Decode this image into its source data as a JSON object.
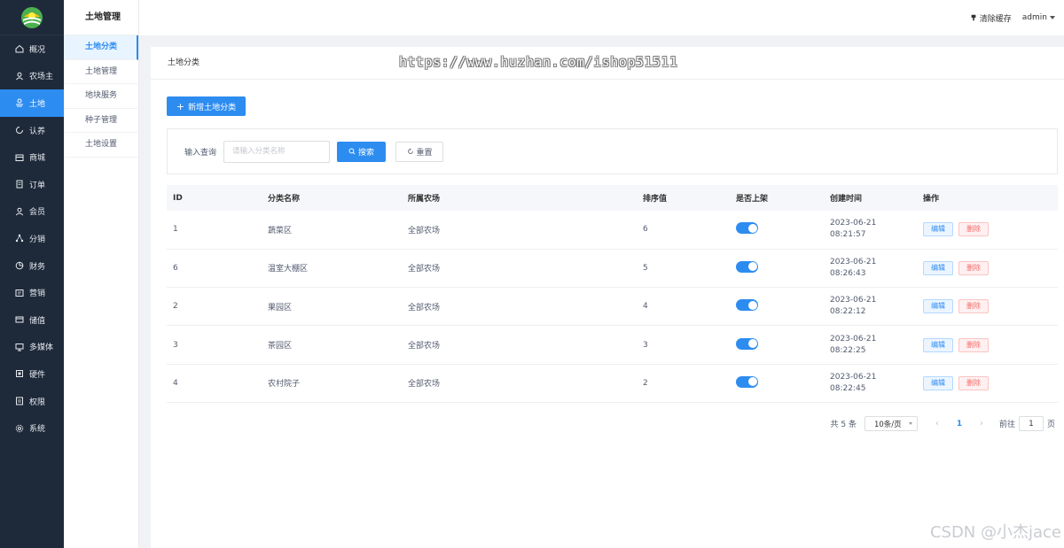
{
  "sidebar": {
    "items": [
      {
        "label": "概况",
        "icon": "home-icon",
        "active": false
      },
      {
        "label": "农场主",
        "icon": "user-icon",
        "active": false
      },
      {
        "label": "土地",
        "icon": "land-icon",
        "active": true
      },
      {
        "label": "认养",
        "icon": "refresh-icon",
        "active": false
      },
      {
        "label": "商城",
        "icon": "shop-icon",
        "active": false
      },
      {
        "label": "订单",
        "icon": "order-icon",
        "active": false
      },
      {
        "label": "会员",
        "icon": "member-icon",
        "active": false
      },
      {
        "label": "分销",
        "icon": "share-icon",
        "active": false
      },
      {
        "label": "财务",
        "icon": "pie-icon",
        "active": false
      },
      {
        "label": "营销",
        "icon": "marketing-icon",
        "active": false
      },
      {
        "label": "储值",
        "icon": "wallet-icon",
        "active": false
      },
      {
        "label": "多媒体",
        "icon": "monitor-icon",
        "active": false
      },
      {
        "label": "硬件",
        "icon": "hardware-icon",
        "active": false
      },
      {
        "label": "权限",
        "icon": "permission-icon",
        "active": false
      },
      {
        "label": "系统",
        "icon": "gear-icon",
        "active": false
      }
    ]
  },
  "submenu": {
    "title": "土地管理",
    "items": [
      "土地分类",
      "土地管理",
      "地块服务",
      "种子管理",
      "土地设置"
    ]
  },
  "header": {
    "clear_cache": "清除缓存",
    "user": "admin"
  },
  "breadcrumb": "土地分类",
  "watermark": "https://www.huzhan.com/ishop51511",
  "add_button": "新增土地分类",
  "search": {
    "label": "输入查询",
    "placeholder": "请输入分类名称",
    "search_button": "搜索",
    "reset_button": "重置"
  },
  "table": {
    "columns": [
      "ID",
      "分类名称",
      "所属农场",
      "排序值",
      "是否上架",
      "创建时间",
      "操作"
    ],
    "rows": [
      {
        "id": "1",
        "name": "蔬菜区",
        "farm": "全部农场",
        "sort": "6",
        "online": true,
        "date": "2023-06-21",
        "time": "08:21:57"
      },
      {
        "id": "6",
        "name": "温室大棚区",
        "farm": "全部农场",
        "sort": "5",
        "online": true,
        "date": "2023-06-21",
        "time": "08:26:43"
      },
      {
        "id": "2",
        "name": "果园区",
        "farm": "全部农场",
        "sort": "4",
        "online": true,
        "date": "2023-06-21",
        "time": "08:22:12"
      },
      {
        "id": "3",
        "name": "茶园区",
        "farm": "全部农场",
        "sort": "3",
        "online": true,
        "date": "2023-06-21",
        "time": "08:22:25"
      },
      {
        "id": "4",
        "name": "农村院子",
        "farm": "全部农场",
        "sort": "2",
        "online": true,
        "date": "2023-06-21",
        "time": "08:22:45"
      }
    ],
    "edit_label": "编辑",
    "delete_label": "删除"
  },
  "pagination": {
    "total": "共 5 条",
    "page_size": "10条/页",
    "current_page": "1",
    "goto_label": "前往",
    "goto_value": "1",
    "page_unit": "页"
  },
  "csdn_watermark": "CSDN @小杰jace",
  "colors": {
    "sidebar_bg": "#1e2a3a",
    "primary": "#2d8cf0",
    "danger": "#f56c6c"
  }
}
